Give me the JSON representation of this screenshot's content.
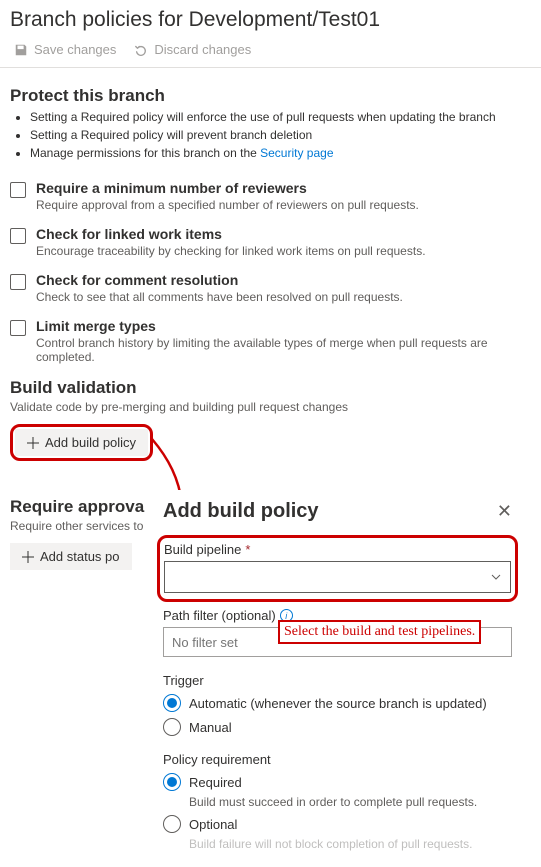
{
  "title": "Branch policies for Development/Test01",
  "toolbar": {
    "save_label": "Save changes",
    "discard_label": "Discard changes"
  },
  "protect": {
    "heading": "Protect this branch",
    "bullets": [
      "Setting a Required policy will enforce the use of pull requests when updating the branch",
      "Setting a Required policy will prevent branch deletion",
      "Manage permissions for this branch on the "
    ],
    "security_link": "Security page"
  },
  "policies": [
    {
      "title": "Require a minimum number of reviewers",
      "desc": "Require approval from a specified number of reviewers on pull requests."
    },
    {
      "title": "Check for linked work items",
      "desc": "Encourage traceability by checking for linked work items on pull requests."
    },
    {
      "title": "Check for comment resolution",
      "desc": "Check to see that all comments have been resolved on pull requests."
    },
    {
      "title": "Limit merge types",
      "desc": "Control branch history by limiting the available types of merge when pull requests are completed."
    }
  ],
  "build_validation": {
    "heading": "Build validation",
    "desc": "Validate code by pre-merging and building pull request changes",
    "add_btn": "Add build policy"
  },
  "require_approval": {
    "heading": "Require approval fr",
    "desc": "Require other services to",
    "add_btn": "Add status po"
  },
  "dialog": {
    "title": "Add build policy",
    "build_pipeline_label": "Build pipeline",
    "path_filter_label": "Path filter (optional)",
    "path_filter_placeholder": "No filter set",
    "trigger_label": "Trigger",
    "trigger_auto": "Automatic (whenever the source branch is updated)",
    "trigger_manual": "Manual",
    "policy_req_label": "Policy requirement",
    "req_required": "Required",
    "req_required_sub": "Build must succeed in order to complete pull requests.",
    "req_optional": "Optional",
    "req_optional_sub": "Build failure will not block completion of pull requests."
  },
  "annotation": "Select the build and test pipelines."
}
